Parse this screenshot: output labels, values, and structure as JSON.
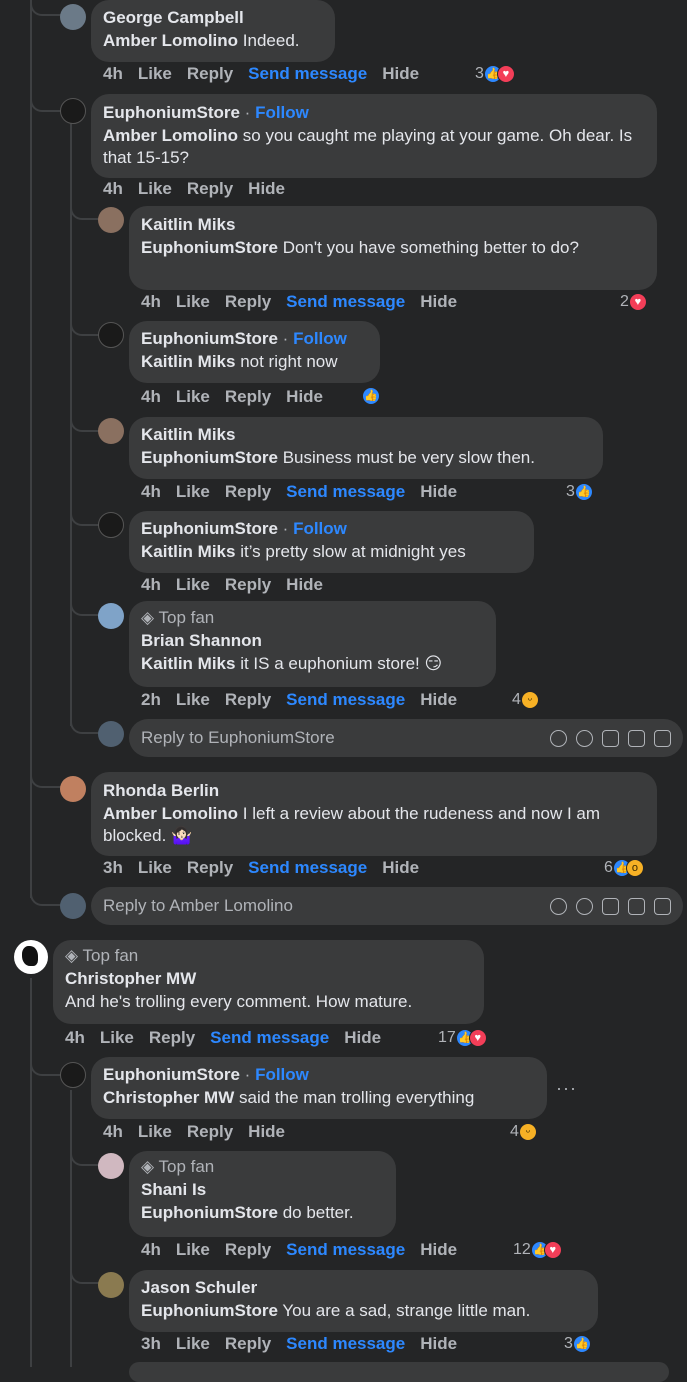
{
  "actions": {
    "like": "Like",
    "reply": "Reply",
    "send": "Send message",
    "hide": "Hide"
  },
  "follow_label": "Follow",
  "top_fan_label": "Top fan",
  "comments": [
    {
      "name": "George Campbell",
      "mention": "Amber Lomolino",
      "text": "Indeed.",
      "time": "4h",
      "count": "3"
    },
    {
      "name": "EuphoniumStore",
      "mention": "Amber Lomolino",
      "text": "so you caught me playing at your game. Oh dear. Is that 15-15?",
      "time": "4h"
    },
    {
      "name": "Kaitlin Miks",
      "mention": "EuphoniumStore",
      "text": "Don't you have something better to do?",
      "time": "4h",
      "count": "2"
    },
    {
      "name": "EuphoniumStore",
      "mention": "Kaitlin Miks",
      "text": "not right now",
      "time": "4h"
    },
    {
      "name": "Kaitlin Miks",
      "mention": "EuphoniumStore",
      "text": "Business must be very slow then.",
      "time": "4h",
      "count": "3"
    },
    {
      "name": "EuphoniumStore",
      "mention": "Kaitlin Miks",
      "text": "it’s pretty slow at midnight yes",
      "time": "4h"
    },
    {
      "name": "Brian Shannon",
      "mention": "Kaitlin Miks",
      "text": "it IS a euphonium store! 😏",
      "time": "2h",
      "count": "4"
    },
    {
      "name": "Rhonda Berlin",
      "mention": "Amber Lomolino",
      "text": "I left a review about the rudeness and now I am blocked. 🤷🏻‍♀️",
      "time": "3h",
      "count": "6"
    },
    {
      "name": "Christopher MW",
      "text": "And he's trolling every comment. How mature.",
      "time": "4h",
      "count": "17"
    },
    {
      "name": "EuphoniumStore",
      "mention": "Christopher MW",
      "text": "said the man trolling everything",
      "time": "4h",
      "count": "4"
    },
    {
      "name": "Shani Is",
      "mention": "EuphoniumStore",
      "text": "do better.",
      "time": "4h",
      "count": "12"
    },
    {
      "name": "Jason Schuler",
      "mention": "EuphoniumStore",
      "text": "You are a sad, strange little man.",
      "time": "3h",
      "count": "3"
    }
  ],
  "reply_boxes": [
    {
      "placeholder": "Reply to EuphoniumStore"
    },
    {
      "placeholder": "Reply to Amber Lomolino"
    }
  ],
  "more_options": "···",
  "colors": {
    "background": "#242526",
    "bubble": "#3a3b3c",
    "link": "#2d88ff",
    "meta": "#b0b3b8"
  }
}
